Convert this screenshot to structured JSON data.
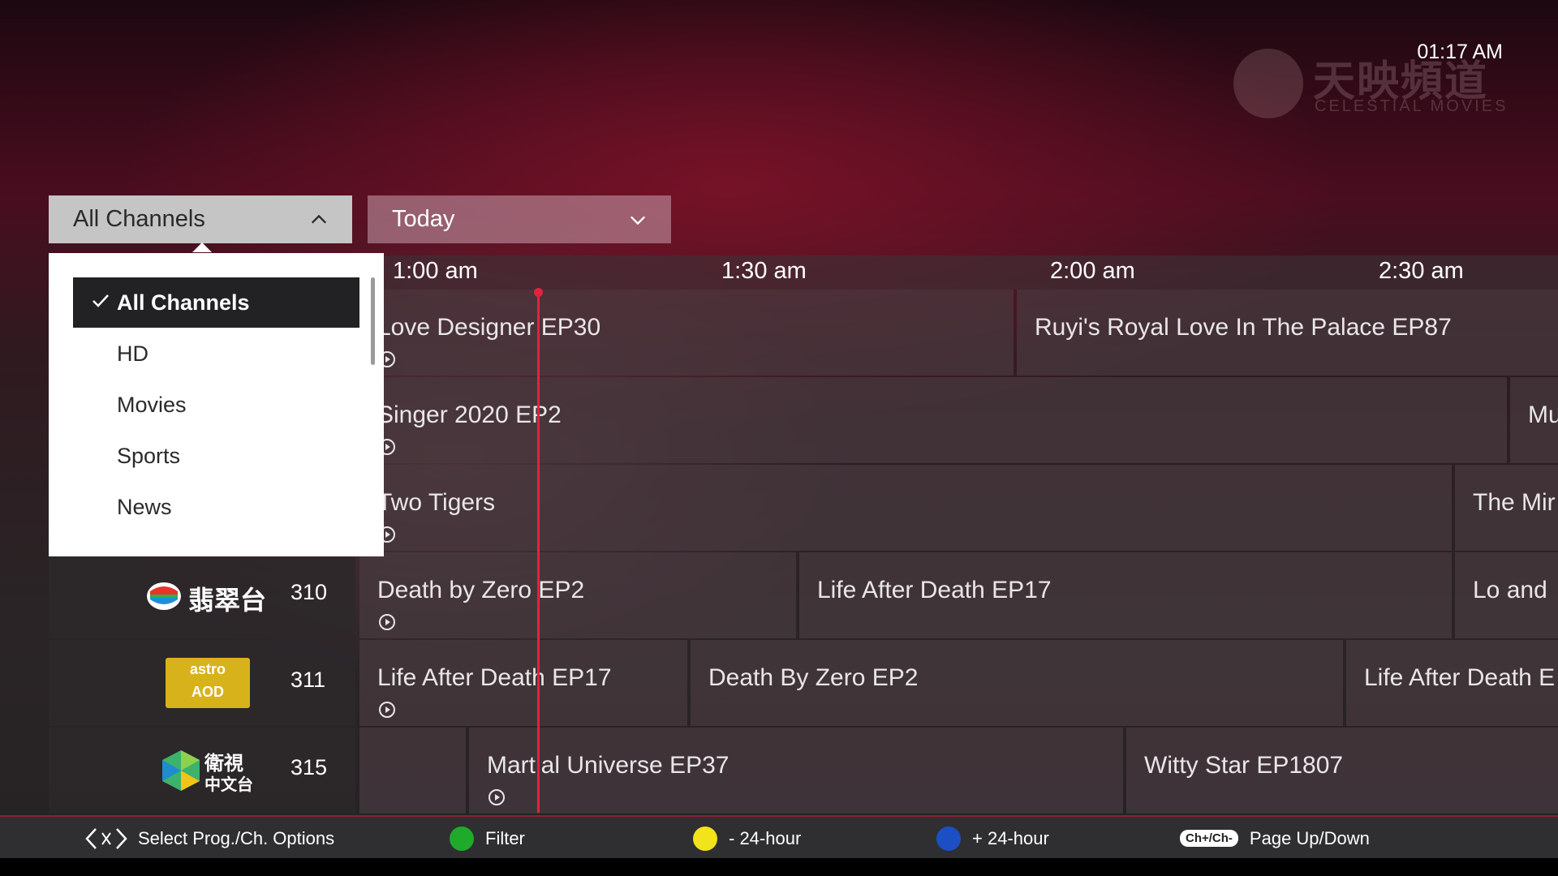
{
  "clock": "01:17 AM",
  "watermark": {
    "cn": "天映頻道",
    "en": "CELESTIAL MOVIES"
  },
  "filters": {
    "channel": {
      "selected": "All Channels",
      "icon": "chevron-up-icon"
    },
    "date": {
      "selected": "Today",
      "icon": "chevron-down-icon"
    }
  },
  "menu": {
    "items": [
      {
        "label": "All Channels",
        "selected": true
      },
      {
        "label": "HD",
        "selected": false
      },
      {
        "label": "Movies",
        "selected": false
      },
      {
        "label": "Sports",
        "selected": false
      },
      {
        "label": "News",
        "selected": false
      }
    ]
  },
  "timeline": {
    "slots": [
      "1:00 am",
      "1:30 am",
      "2:00 am",
      "2:30 am"
    ]
  },
  "channels": [
    {
      "number": "",
      "programs": [
        "Love Designer EP30",
        "Ruyi's Royal Love In The Palace EP87"
      ]
    },
    {
      "number": "",
      "programs": [
        "Singer 2020 EP2",
        "Mu"
      ]
    },
    {
      "number": "",
      "programs": [
        "Two Tigers",
        "The Mir"
      ]
    },
    {
      "number": "310",
      "logo_text": "翡翠台",
      "programs": [
        "Death by Zero EP2",
        "Life After Death EP17",
        "Lo and"
      ]
    },
    {
      "number": "311",
      "logo_text": [
        "astro",
        "AOD"
      ],
      "programs": [
        "Life After Death EP17",
        "Death By Zero EP2",
        "Life After Death E"
      ]
    },
    {
      "number": "315",
      "logo_text": [
        "衛視",
        "中文台"
      ],
      "programs": [
        "",
        "Martial Universe EP37",
        "Witty Star EP1807"
      ]
    }
  ],
  "footer": {
    "nav": {
      "label": "Select Prog./Ch. Options",
      "icon": "left-right-arrows-icon"
    },
    "green": {
      "label": "Filter",
      "color": "#1faa2b"
    },
    "yellow": {
      "label": "- 24-hour",
      "color": "#f2e31a"
    },
    "blue": {
      "label": "+ 24-hour",
      "color": "#1c4fc4"
    },
    "page": {
      "pill": "Ch+/Ch-",
      "label": "Page Up/Down"
    }
  }
}
